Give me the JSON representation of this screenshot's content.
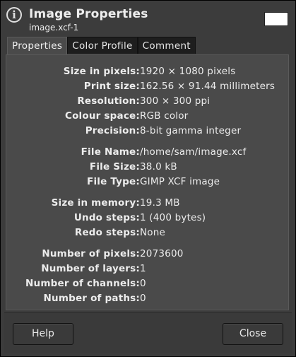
{
  "window": {
    "title": "Image Properties",
    "subtitle": "image.xcf-1"
  },
  "tabs": [
    {
      "label": "Properties",
      "active": true
    },
    {
      "label": "Color Profile",
      "active": false
    },
    {
      "label": "Comment",
      "active": false
    }
  ],
  "properties": {
    "size_pixels": {
      "label": "Size in pixels:",
      "value": "1920 × 1080 pixels"
    },
    "print_size": {
      "label": "Print size:",
      "value": "162.56 × 91.44 millimeters"
    },
    "resolution": {
      "label": "Resolution:",
      "value": "300 × 300 ppi"
    },
    "colour_space": {
      "label": "Colour space:",
      "value": "RGB color"
    },
    "precision": {
      "label": "Precision:",
      "value": "8-bit gamma integer"
    },
    "file_name": {
      "label": "File Name:",
      "value": "/home/sam/image.xcf"
    },
    "file_size": {
      "label": "File Size:",
      "value": "38.0 kB"
    },
    "file_type": {
      "label": "File Type:",
      "value": "GIMP XCF image"
    },
    "size_memory": {
      "label": "Size in memory:",
      "value": "19.3 MB"
    },
    "undo_steps": {
      "label": "Undo steps:",
      "value": "1 (400 bytes)"
    },
    "redo_steps": {
      "label": "Redo steps:",
      "value": "None"
    },
    "num_pixels": {
      "label": "Number of pixels:",
      "value": "2073600"
    },
    "num_layers": {
      "label": "Number of layers:",
      "value": "1"
    },
    "num_channels": {
      "label": "Number of channels:",
      "value": "0"
    },
    "num_paths": {
      "label": "Number of paths:",
      "value": "0"
    }
  },
  "buttons": {
    "help": "Help",
    "close": "Close"
  },
  "icons": {
    "info": "info-icon"
  }
}
